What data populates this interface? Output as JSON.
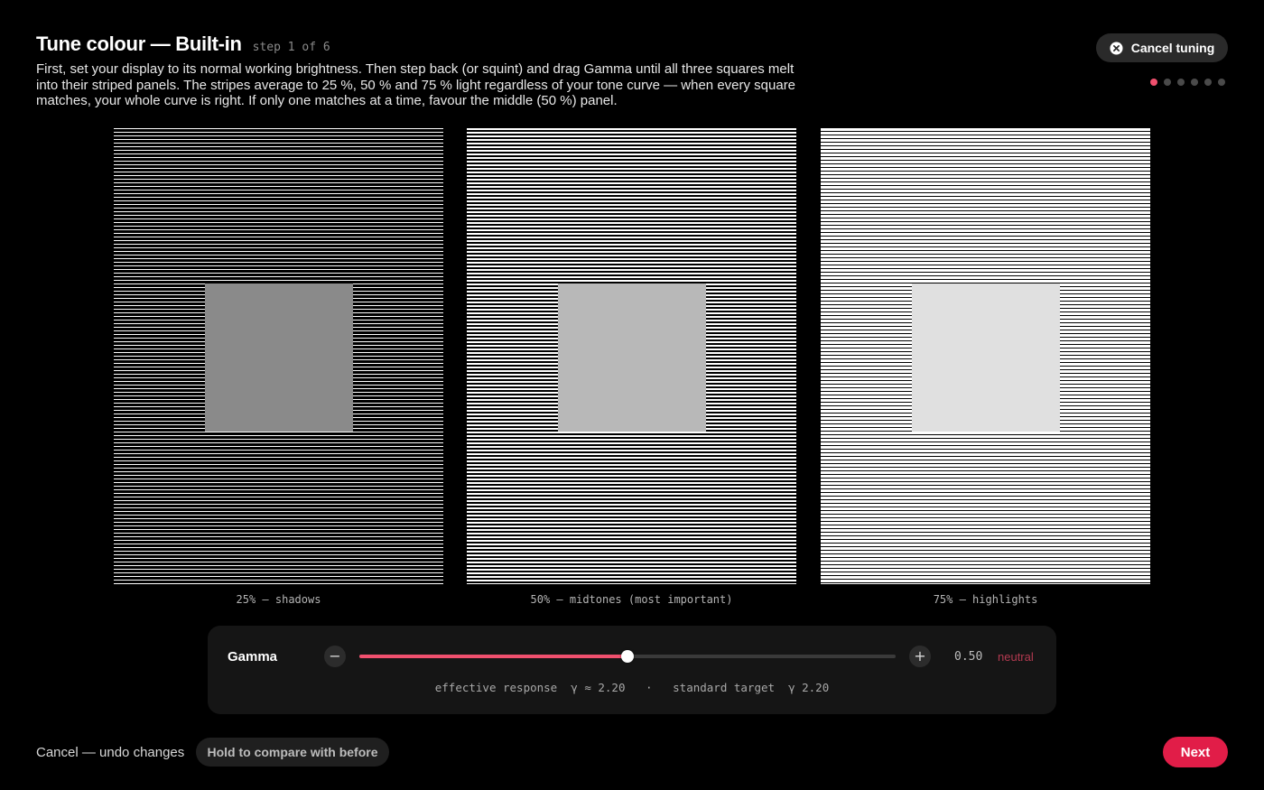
{
  "header": {
    "title": "Tune colour — Built-in",
    "step": "step 1 of 6",
    "description": "First, set your display to its normal working brightness. Then step back (or squint) and drag Gamma until all three squares melt into their striped panels. The stripes average to 25 %, 50 % and 75 % light regardless of your tone curve — when every square matches, your whole curve is right. If only one matches at a time, favour the middle (50 %) panel.",
    "cancel_tuning_label": "Cancel tuning",
    "cancel_icon": "close-circle-icon",
    "steps_total": 6,
    "step_current": 1
  },
  "panels": [
    {
      "label": "25% — shadows",
      "stripe_white_fraction": 0.25,
      "square_color": "#8a8a8a"
    },
    {
      "label": "50% — midtones (most important)",
      "stripe_white_fraction": 0.5,
      "square_color": "#b8b8b8"
    },
    {
      "label": "75% — highlights",
      "stripe_white_fraction": 0.75,
      "square_color": "#e0e0e0"
    }
  ],
  "gamma": {
    "label": "Gamma",
    "minus_icon": "minus-icon",
    "plus_icon": "plus-icon",
    "minus_symbol": "−",
    "plus_symbol": "+",
    "slider_fraction": 0.5,
    "value": "0.50",
    "state": "neutral",
    "response_text": "effective response  γ ≈ 2.20   ·   standard target  γ 2.20"
  },
  "footer": {
    "undo_label": "Cancel — undo changes",
    "compare_label": "Hold to compare with before",
    "next_label": "Next"
  },
  "colors": {
    "accent": "#f0506e",
    "primary_button": "#e11d48",
    "background": "#000000"
  }
}
